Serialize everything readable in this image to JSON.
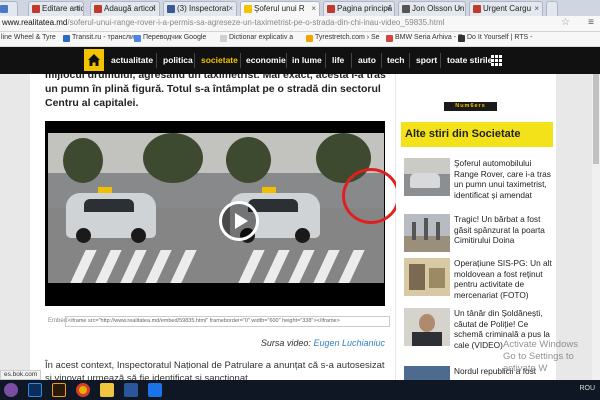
{
  "browser": {
    "tabs": [
      {
        "label": "Editare articol"
      },
      {
        "label": "Adaugă articol"
      },
      {
        "label": "(3) Inspectorat"
      },
      {
        "label": "Şoferul unui R"
      },
      {
        "label": "Pagina principă"
      },
      {
        "label": "Jon Olsson Un"
      },
      {
        "label": "Urgent Cargu"
      }
    ],
    "url_domain": "www.realitatea.md",
    "url_path": "/soferul-unui-range-rover-i-a-permis-sa-agreseze-un-taximetrist-pe-o-strada-din-chi-inau-video_59835.html",
    "bookmarks": [
      {
        "label": "line Wheel & Tyre"
      },
      {
        "label": "Transit.ru - транслит"
      },
      {
        "label": "Переводчик Google"
      },
      {
        "label": "Dictionar explicativ a"
      },
      {
        "label": "Tyrestretch.com › Se"
      },
      {
        "label": "BMW Seria Arhiva - D"
      },
      {
        "label": "Do It Yourself | RTS -"
      }
    ]
  },
  "site_nav": {
    "items": [
      {
        "label": "actualitate"
      },
      {
        "label": "politica"
      },
      {
        "label": "societate"
      },
      {
        "label": "economie"
      },
      {
        "label": "in lume"
      },
      {
        "label": "life"
      },
      {
        "label": "auto"
      },
      {
        "label": "tech"
      },
      {
        "label": "sport"
      },
      {
        "label": "toate stirile"
      }
    ],
    "active": "societate",
    "accent_color": "#f3c300"
  },
  "article": {
    "lead": "mijlocul drumului, agresând un taximetrist. Mai exact, acesta i-a tras un pumn în plină figură. Totul s-a întâmplat pe o stradă din sectorul Centru al capitalei.",
    "embed_label": "Embed:",
    "embed_code": "<iframe src=\"http://www.realitatea.md/embed/59835.html\" frameborder=\"0\" width=\"600\" height=\"338\"></iframe>",
    "source_label": "Sursa video:",
    "source_author": "Eugen Luchianiuc",
    "body": "În acest context, Inspectoratul Național de Patrulare a anunțat că s-a autosesizat și vinovat urmează să fie identificat și sancționat."
  },
  "sidebar": {
    "logo": "Num6ers",
    "heading": "Alte stiri din Societate",
    "stories": [
      {
        "title": "Şoferul automobilului Range Rover, care i-a tras un pumn unui taximetrist, identificat și amendat"
      },
      {
        "title": "Tragic! Un bărbat a fost găsit spânzurat la poarta Cimitirului Doina"
      },
      {
        "title": "Operațiune SIS-PG: Un alt moldovean a fost reținut pentru activitate de mercenariat (FOTO)"
      },
      {
        "title": "Un tânăr din Șoldănești, căutat de Poliție! Ce schemă criminală a pus la cale (VIDEO)"
      },
      {
        "title": "Nordul republicii a fost"
      }
    ]
  },
  "os": {
    "watermark_line1": "Activate Windows",
    "watermark_line2": "Go to Settings to activate W",
    "status": "es.bok.com",
    "lang": "ROU"
  }
}
